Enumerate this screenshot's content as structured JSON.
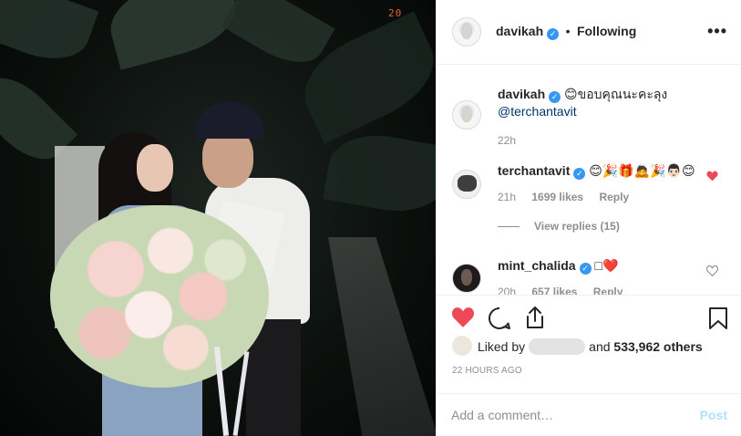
{
  "photo": {
    "overlay_text": "20"
  },
  "header": {
    "username": "davikah",
    "separator": "•",
    "follow_status": "Following",
    "more_icon": "more-horizontal-icon"
  },
  "caption": {
    "username": "davikah",
    "emoji": "😊",
    "text": "ขอบคุณนะคะลุง",
    "mention": "@terchantavit",
    "time": "22h"
  },
  "comments": [
    {
      "username": "terchantavit",
      "text": "😊🎉🎁🙇🎉👨🏻😊",
      "time": "21h",
      "likes": "1699 likes",
      "reply": "Reply",
      "liked": true,
      "view_replies": "View replies (15)"
    },
    {
      "username": "mint_chalida",
      "text": "□❤️",
      "time": "20h",
      "likes": "657 likes",
      "reply": "Reply",
      "liked": false
    }
  ],
  "actions": {
    "liked_by_prefix": "Liked by",
    "liked_by_suffix": "and",
    "others": "533,962 others",
    "timestamp": "22 HOURS AGO",
    "comment_placeholder": "Add a comment…",
    "post_label": "Post"
  },
  "colors": {
    "like_red": "#ed4956",
    "verified_blue": "#3897f0",
    "post_disabled": "#b2dffc",
    "meta_gray": "#8e8e8e"
  }
}
